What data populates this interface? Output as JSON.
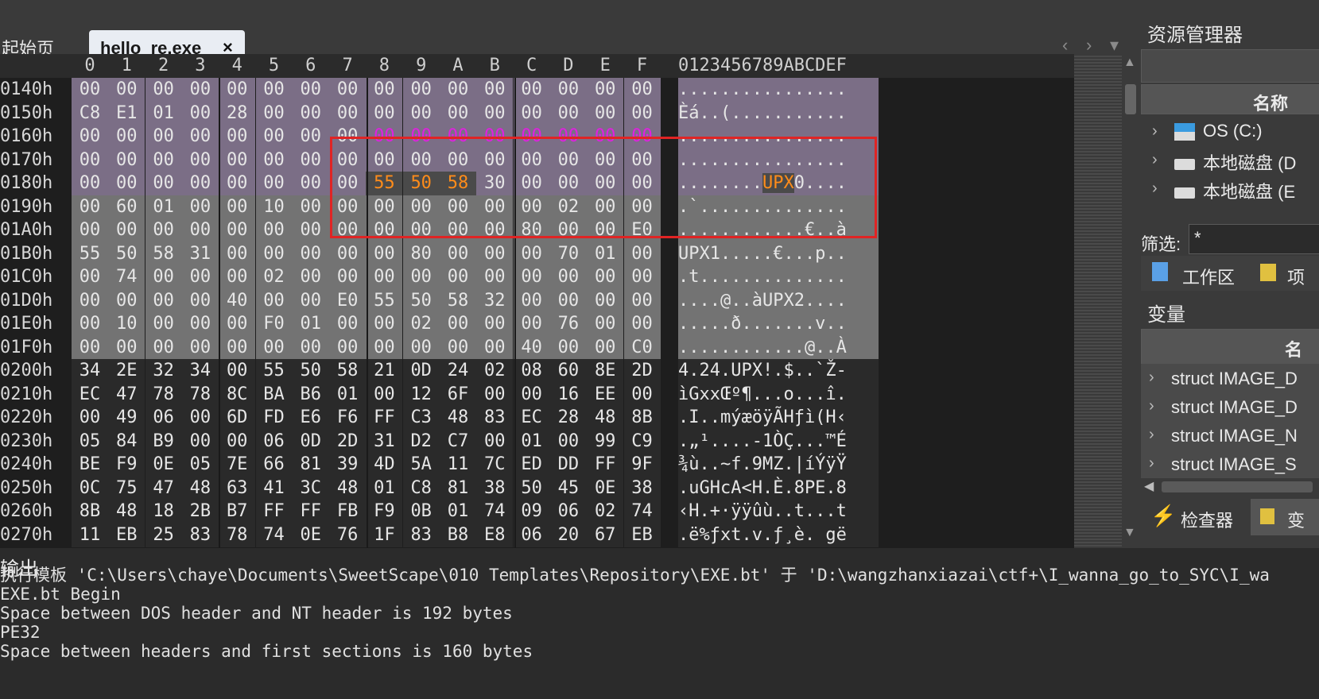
{
  "tabs": {
    "start_label": "起始页",
    "file_label": "hello_re.exe",
    "close_glyph": "×"
  },
  "nav": {
    "back": "‹",
    "forward": "›",
    "menu": "▾"
  },
  "hex_view": {
    "column_headers": [
      "0",
      "1",
      "2",
      "3",
      "4",
      "5",
      "6",
      "7",
      "8",
      "9",
      "A",
      "B",
      "C",
      "D",
      "E",
      "F"
    ],
    "ascii_header": "0123456789ABCDEF",
    "rows": [
      {
        "addr": "0140h",
        "bytes": [
          "00",
          "00",
          "00",
          "00",
          "00",
          "00",
          "00",
          "00",
          "00",
          "00",
          "00",
          "00",
          "00",
          "00",
          "00",
          "00"
        ],
        "ascii": "................",
        "bg": "purple"
      },
      {
        "addr": "0150h",
        "bytes": [
          "C8",
          "E1",
          "01",
          "00",
          "28",
          "00",
          "00",
          "00",
          "00",
          "00",
          "00",
          "00",
          "00",
          "00",
          "00",
          "00"
        ],
        "ascii": "Èá..(...........",
        "bg": "purple"
      },
      {
        "addr": "0160h",
        "bytes": [
          "00",
          "00",
          "00",
          "00",
          "00",
          "00",
          "00",
          "00",
          "00",
          "00",
          "00",
          "00",
          "00",
          "00",
          "00",
          "00"
        ],
        "ascii": "................",
        "bg": "purple"
      },
      {
        "addr": "0170h",
        "bytes": [
          "00",
          "00",
          "00",
          "00",
          "00",
          "00",
          "00",
          "00",
          "00",
          "00",
          "00",
          "00",
          "00",
          "00",
          "00",
          "00"
        ],
        "ascii": "................",
        "bg": "purple"
      },
      {
        "addr": "0180h",
        "bytes": [
          "00",
          "00",
          "00",
          "00",
          "00",
          "00",
          "00",
          "00",
          "55",
          "50",
          "58",
          "30",
          "00",
          "00",
          "00",
          "00"
        ],
        "ascii": "........UPX0....",
        "bg": "purple"
      },
      {
        "addr": "0190h",
        "bytes": [
          "00",
          "60",
          "01",
          "00",
          "00",
          "10",
          "00",
          "00",
          "00",
          "00",
          "00",
          "00",
          "00",
          "02",
          "00",
          "00"
        ],
        "ascii": ".`..............",
        "bg": "gray"
      },
      {
        "addr": "01A0h",
        "bytes": [
          "00",
          "00",
          "00",
          "00",
          "00",
          "00",
          "00",
          "00",
          "00",
          "00",
          "00",
          "00",
          "80",
          "00",
          "00",
          "E0"
        ],
        "ascii": "............€..à",
        "bg": "gray"
      },
      {
        "addr": "01B0h",
        "bytes": [
          "55",
          "50",
          "58",
          "31",
          "00",
          "00",
          "00",
          "00",
          "00",
          "80",
          "00",
          "00",
          "00",
          "70",
          "01",
          "00"
        ],
        "ascii": "UPX1.....€...p..",
        "bg": "gray"
      },
      {
        "addr": "01C0h",
        "bytes": [
          "00",
          "74",
          "00",
          "00",
          "00",
          "02",
          "00",
          "00",
          "00",
          "00",
          "00",
          "00",
          "00",
          "00",
          "00",
          "00"
        ],
        "ascii": ".t..............",
        "bg": "gray"
      },
      {
        "addr": "01D0h",
        "bytes": [
          "00",
          "00",
          "00",
          "00",
          "40",
          "00",
          "00",
          "E0",
          "55",
          "50",
          "58",
          "32",
          "00",
          "00",
          "00",
          "00"
        ],
        "ascii": "....@..àUPX2....",
        "bg": "gray"
      },
      {
        "addr": "01E0h",
        "bytes": [
          "00",
          "10",
          "00",
          "00",
          "00",
          "F0",
          "01",
          "00",
          "00",
          "02",
          "00",
          "00",
          "00",
          "76",
          "00",
          "00"
        ],
        "ascii": ".....ð.......v..",
        "bg": "gray"
      },
      {
        "addr": "01F0h",
        "bytes": [
          "00",
          "00",
          "00",
          "00",
          "00",
          "00",
          "00",
          "00",
          "00",
          "00",
          "00",
          "00",
          "40",
          "00",
          "00",
          "C0"
        ],
        "ascii": "............@..À",
        "bg": "gray"
      },
      {
        "addr": "0200h",
        "bytes": [
          "34",
          "2E",
          "32",
          "34",
          "00",
          "55",
          "50",
          "58",
          "21",
          "0D",
          "24",
          "02",
          "08",
          "60",
          "8E",
          "2D"
        ],
        "ascii": "4.24.UPX!.$..`Ž-",
        "bg": "dark"
      },
      {
        "addr": "0210h",
        "bytes": [
          "EC",
          "47",
          "78",
          "78",
          "8C",
          "BA",
          "B6",
          "01",
          "00",
          "12",
          "6F",
          "00",
          "00",
          "16",
          "EE",
          "00"
        ],
        "ascii": "ìGxxŒº¶...o...î.",
        "bg": "dark"
      },
      {
        "addr": "0220h",
        "bytes": [
          "00",
          "49",
          "06",
          "00",
          "6D",
          "FD",
          "E6",
          "F6",
          "FF",
          "C3",
          "48",
          "83",
          "EC",
          "28",
          "48",
          "8B"
        ],
        "ascii": ".I..mýæöÿÃHƒì(H‹",
        "bg": "dark"
      },
      {
        "addr": "0230h",
        "bytes": [
          "05",
          "84",
          "B9",
          "00",
          "00",
          "06",
          "0D",
          "2D",
          "31",
          "D2",
          "C7",
          "00",
          "01",
          "00",
          "99",
          "C9"
        ],
        "ascii": ".„¹....-1ÒÇ...™É",
        "bg": "dark"
      },
      {
        "addr": "0240h",
        "bytes": [
          "BE",
          "F9",
          "0E",
          "05",
          "7E",
          "66",
          "81",
          "39",
          "4D",
          "5A",
          "11",
          "7C",
          "ED",
          "DD",
          "FF",
          "9F"
        ],
        "ascii": "¾ù..~f.9MZ.|íÝÿŸ",
        "bg": "dark"
      },
      {
        "addr": "0250h",
        "bytes": [
          "0C",
          "75",
          "47",
          "48",
          "63",
          "41",
          "3C",
          "48",
          "01",
          "C8",
          "81",
          "38",
          "50",
          "45",
          "0E",
          "38"
        ],
        "ascii": ".uGHcA<H.È.8PE.8",
        "bg": "dark"
      },
      {
        "addr": "0260h",
        "bytes": [
          "8B",
          "48",
          "18",
          "2B",
          "B7",
          "FF",
          "FF",
          "FB",
          "F9",
          "0B",
          "01",
          "74",
          "09",
          "06",
          "02",
          "74"
        ],
        "ascii": "‹H.+·ÿÿûù..t...t",
        "bg": "dark"
      },
      {
        "addr": "0270h",
        "bytes": [
          "11",
          "EB",
          "25",
          "83",
          "78",
          "74",
          "0E",
          "76",
          "1F",
          "83",
          "B8",
          "E8",
          "06",
          "20",
          "67",
          "EB"
        ],
        "ascii": ".ë%ƒxt.v.ƒ¸è. gë",
        "bg": "dark"
      }
    ]
  },
  "resource_manager": {
    "title": "资源管理器",
    "column_name": "名称",
    "items": [
      {
        "label": "OS (C:)",
        "icon": "os-drive-icon"
      },
      {
        "label": "本地磁盘 (D",
        "icon": "drive-icon"
      },
      {
        "label": "本地磁盘 (E",
        "icon": "drive-icon"
      }
    ],
    "filter_label": "筛选:",
    "filter_value": "*",
    "tabs": [
      "工作区",
      "项"
    ]
  },
  "variables": {
    "title": "变量",
    "column_name": "名",
    "items": [
      "struct IMAGE_D",
      "struct IMAGE_D",
      "struct IMAGE_N",
      "struct IMAGE_S"
    ]
  },
  "bottom_tabs": {
    "inspector": "检查器",
    "other": "变"
  },
  "output": {
    "title": "输出",
    "lines": [
      "执行模板 'C:\\Users\\chaye\\Documents\\SweetScape\\010 Templates\\Repository\\EXE.bt' 于 'D:\\wangzhanxiazai\\ctf+\\I_wanna_go_to_SYC\\I_wa",
      "EXE.bt Begin",
      "Space between DOS header and NT header is 192 bytes",
      "PE32",
      "Space between headers and first sections is 160 bytes"
    ]
  },
  "colors": {
    "accent_orange": "#ff8c1a",
    "magenta": "#e020e0",
    "highlight_red": "#e02424"
  }
}
